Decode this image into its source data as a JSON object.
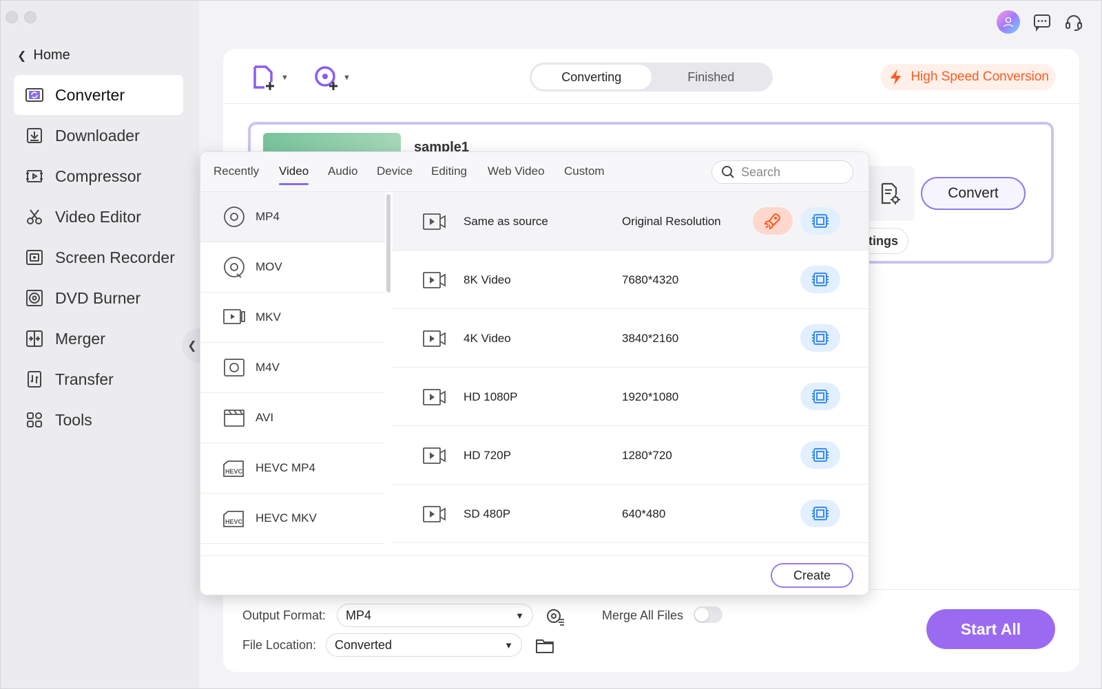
{
  "sidebar": {
    "home_label": "Home",
    "items": [
      {
        "label": "Converter",
        "icon": "converter-icon",
        "active": true
      },
      {
        "label": "Downloader",
        "icon": "downloader-icon"
      },
      {
        "label": "Compressor",
        "icon": "compressor-icon"
      },
      {
        "label": "Video Editor",
        "icon": "scissors-icon"
      },
      {
        "label": "Screen Recorder",
        "icon": "screen-recorder-icon"
      },
      {
        "label": "DVD Burner",
        "icon": "disc-icon"
      },
      {
        "label": "Merger",
        "icon": "merger-icon"
      },
      {
        "label": "Transfer",
        "icon": "transfer-icon"
      },
      {
        "label": "Tools",
        "icon": "tools-grid-icon"
      }
    ]
  },
  "toolbar": {
    "tabs": {
      "converting": "Converting",
      "finished": "Finished"
    },
    "high_speed_label": "High Speed Conversion",
    "accent_color": "#9a6bf1",
    "high_speed_color": "#ff5a1f"
  },
  "file": {
    "name": "sample1",
    "convert_label": "Convert",
    "settings_label": "tings"
  },
  "popup": {
    "tabs": [
      "Recently",
      "Video",
      "Audio",
      "Device",
      "Editing",
      "Web Video",
      "Custom"
    ],
    "active_tab": "Video",
    "search_placeholder": "Search",
    "formats": [
      {
        "label": "MP4",
        "icon": "mp4-icon"
      },
      {
        "label": "MOV",
        "icon": "mov-icon"
      },
      {
        "label": "MKV",
        "icon": "mkv-icon"
      },
      {
        "label": "M4V",
        "icon": "m4v-icon"
      },
      {
        "label": "AVI",
        "icon": "avi-icon"
      },
      {
        "label": "HEVC MP4",
        "icon": "hevc-icon",
        "badge": "HEVC"
      },
      {
        "label": "HEVC MKV",
        "icon": "hevc-icon",
        "badge": "HEVC"
      }
    ],
    "resolutions": [
      {
        "name": "Same as source",
        "res": "Original Resolution",
        "rocket": true
      },
      {
        "name": "8K Video",
        "res": "7680*4320"
      },
      {
        "name": "4K Video",
        "res": "3840*2160"
      },
      {
        "name": "HD 1080P",
        "res": "1920*1080"
      },
      {
        "name": "HD 720P",
        "res": "1280*720"
      },
      {
        "name": "SD 480P",
        "res": "640*480"
      }
    ],
    "create_label": "Create"
  },
  "bottom": {
    "output_format_label": "Output Format:",
    "output_format_value": "MP4",
    "merge_label": "Merge All Files",
    "merge_on": false,
    "file_location_label": "File Location:",
    "file_location_value": "Converted",
    "start_all_label": "Start All"
  }
}
